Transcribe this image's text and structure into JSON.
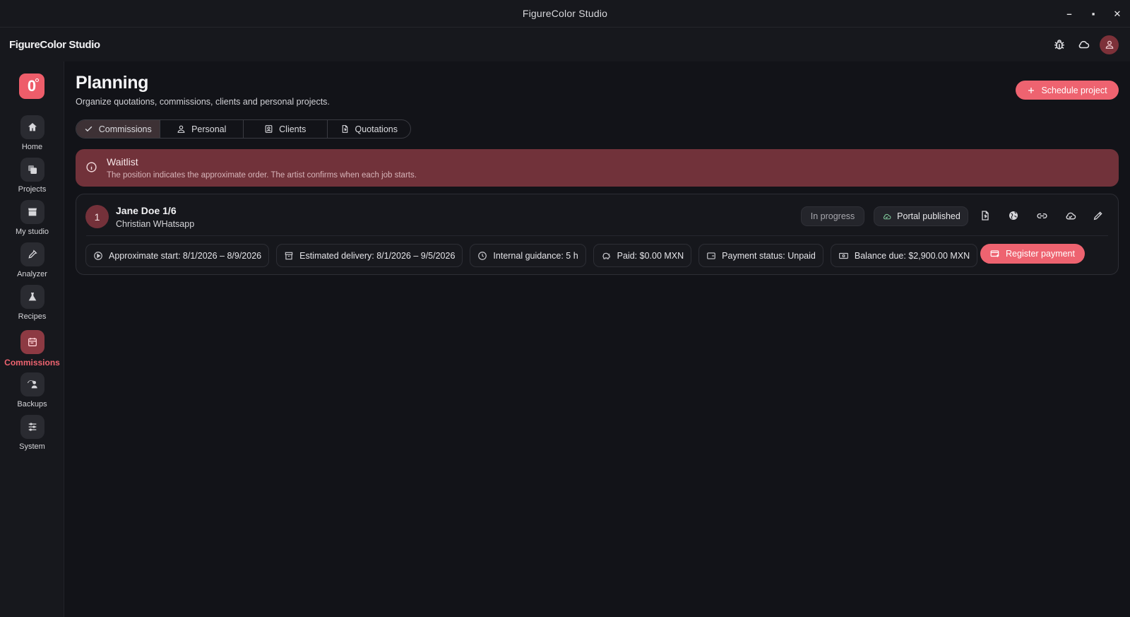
{
  "window": {
    "title": "FigureColor Studio",
    "minimize": "–",
    "maximize": "▪",
    "close": "✕"
  },
  "header": {
    "app_name": "FigureColor Studio",
    "icons": [
      "bug-icon",
      "cloud-icon",
      "user-icon"
    ]
  },
  "logo": {
    "text": "0"
  },
  "sidebar": {
    "items": [
      {
        "label": "Home",
        "icon": "home-icon"
      },
      {
        "label": "Projects",
        "icon": "projects-icon"
      },
      {
        "label": "My studio",
        "icon": "store-icon"
      },
      {
        "label": "Analyzer",
        "icon": "eyedropper-icon"
      },
      {
        "label": "Recipes",
        "icon": "flask-icon"
      },
      {
        "label": "Commissions",
        "icon": "calendar-icon",
        "active": true
      },
      {
        "label": "Backups",
        "icon": "backup-icon"
      },
      {
        "label": "System",
        "icon": "sliders-icon"
      }
    ]
  },
  "page": {
    "title": "Planning",
    "subtitle": "Organize quotations, commissions, clients and personal projects.",
    "schedule_button": "Schedule project"
  },
  "tabs": [
    {
      "label": "Commissions",
      "icon": "check-icon",
      "active": true
    },
    {
      "label": "Personal",
      "icon": "person-icon"
    },
    {
      "label": "Clients",
      "icon": "contacts-icon"
    },
    {
      "label": "Quotations",
      "icon": "document-icon"
    }
  ],
  "banner": {
    "title": "Waitlist",
    "text": "The position indicates the approximate order. The artist confirms when each job starts."
  },
  "commission": {
    "position": "1",
    "client_name": "Jane Doe 1/6",
    "contact": "Christian WHatsapp",
    "status": "In progress",
    "portal": "Portal published",
    "actions": [
      "invoice-icon",
      "globe-icon",
      "link-icon",
      "cloud-sync-icon",
      "edit-icon"
    ],
    "meta": {
      "start": "Approximate start: 8/1/2026 – 8/9/2026",
      "delivery": "Estimated delivery: 8/1/2026 – 9/5/2026",
      "guidance": "Internal guidance: 5 h",
      "paid": "Paid: $0.00 MXN",
      "payment_status": "Payment status: Unpaid",
      "balance": "Balance due: $2,900.00 MXN"
    },
    "register_button": "Register payment"
  },
  "colors": {
    "accent": "#ee6370",
    "banner": "#71323a",
    "background": "#121318",
    "panel": "#17181d"
  }
}
